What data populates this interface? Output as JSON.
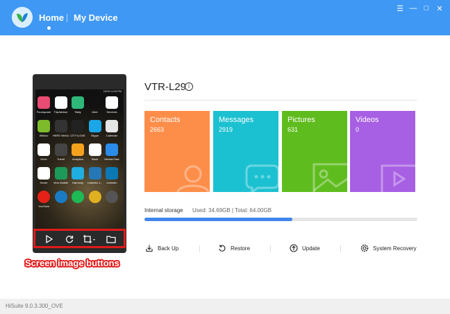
{
  "header": {
    "nav_home": "Home",
    "nav_device": "My Device",
    "window_controls": [
      "☰",
      "—",
      "□",
      "✕"
    ]
  },
  "device": {
    "model": "VTR-L29"
  },
  "tiles": [
    {
      "label": "Contacts",
      "count": "2663",
      "color": "#fd8e4a"
    },
    {
      "label": "Messages",
      "count": "2919",
      "color": "#1cc1d1"
    },
    {
      "label": "Pictures",
      "count": "631",
      "color": "#5fbc1e"
    },
    {
      "label": "Videos",
      "count": "0",
      "color": "#a75fe3"
    }
  ],
  "storage": {
    "label": "Internal storage",
    "used_text": "Used: 34.69GB | Total: 64.00GB",
    "used_fraction": 0.542
  },
  "actions": {
    "backup": "Back Up",
    "restore": "Restore",
    "update": "Update",
    "recovery": "System Recovery"
  },
  "phone": {
    "status_text": "100% 9:28 PM",
    "apps": [
      {
        "label": "Foursquare",
        "color": "#e84c72"
      },
      {
        "label": "TripAdvisor",
        "color": "#ffffff"
      },
      {
        "label": "Tasty",
        "color": "#2fb77a"
      },
      {
        "label": "Uber",
        "color": "#111111"
      },
      {
        "label": "Services",
        "color": "#ffffff"
      },
      {
        "label": "Wikiloc",
        "color": "#7dbb2a"
      },
      {
        "label": "HERE WeGo",
        "color": "#333333"
      },
      {
        "label": "CITY iLOVE",
        "color": "#222222"
      },
      {
        "label": "Skype",
        "color": "#1ba6e8"
      },
      {
        "label": "Calendar",
        "color": "#e6e6e6"
      },
      {
        "label": "Drive",
        "color": "#ffffff"
      },
      {
        "label": "Travel",
        "color": "#444444"
      },
      {
        "label": "Analytics",
        "color": "#f4a21d"
      },
      {
        "label": "Slack",
        "color": "#ffffff"
      },
      {
        "label": "MeisterTask",
        "color": "#2a8ce8"
      },
      {
        "label": "Home",
        "color": "#ffffff"
      },
      {
        "label": "Vero Mobile",
        "color": "#1d9a5a"
      },
      {
        "label": "Harmony",
        "color": "#1faee0"
      },
      {
        "label": "LinkedIn J...",
        "color": "#2577b5"
      },
      {
        "label": "LinkedIn",
        "color": "#0b78b5"
      },
      {
        "label": "YouTube",
        "color": "#e62117"
      },
      {
        "label": "",
        "color": "#1a7bc4"
      },
      {
        "label": "",
        "color": "#1db954"
      },
      {
        "label": "",
        "color": "#e0b020"
      },
      {
        "label": "",
        "color": "#555555"
      }
    ]
  },
  "callout": "Screen image buttons",
  "footer": {
    "version": "HiSuite 9.0.3.300_OVE"
  }
}
